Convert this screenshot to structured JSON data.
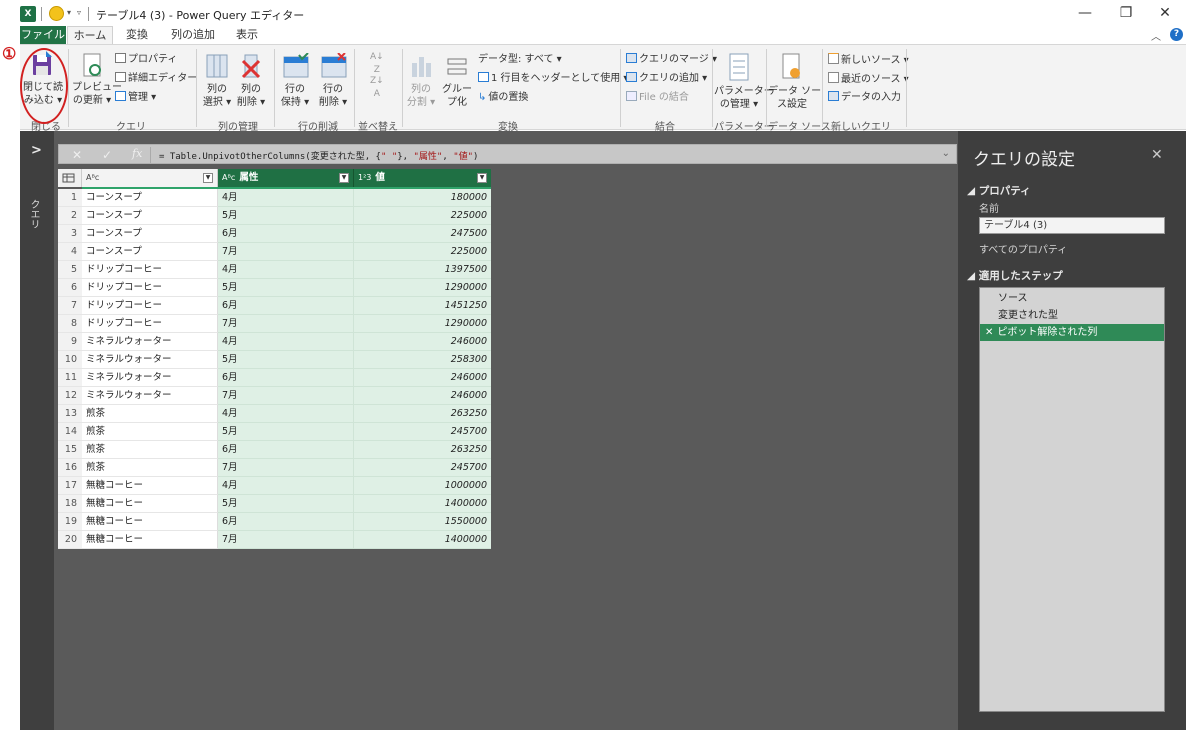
{
  "window": {
    "title": "テーブル4 (3) - Power Query エディター",
    "app_icon": "excel-icon",
    "controls": [
      "—",
      "❐",
      "✕"
    ]
  },
  "tabs": [
    "ファイル",
    "ホーム",
    "変換",
    "列の追加",
    "表示"
  ],
  "ribbon": {
    "close": {
      "line1": "閉じて読",
      "line2": "み込む ▾",
      "group": "閉じる"
    },
    "query": {
      "preview_line1": "プレビュー",
      "preview_line2": "の更新 ▾",
      "properties": "プロパティ",
      "advanced_editor": "詳細エディター",
      "manage": "管理 ▾",
      "group": "クエリ"
    },
    "manage_columns": {
      "choose_line1": "列の",
      "choose_line2": "選択 ▾",
      "remove_line1": "列の",
      "remove_line2": "削除 ▾",
      "group": "列の管理"
    },
    "reduce_rows": {
      "keep_line1": "行の",
      "keep_line2": "保持 ▾",
      "remove_line1": "行の",
      "remove_line2": "削除 ▾",
      "group": "行の削減"
    },
    "sort": {
      "group": "並べ替え"
    },
    "transform": {
      "split_line1": "列の",
      "split_line2": "分割 ▾",
      "group_line1": "グルー",
      "group_line2": "プ化",
      "data_type": "データ型: すべて ▾",
      "first_row_header": "1 行目をヘッダーとして使用 ▾",
      "replace_values": "値の置換",
      "group": "変換"
    },
    "combine": {
      "merge": "クエリのマージ ▾",
      "append": "クエリの追加 ▾",
      "combine_files": "File の結合",
      "group": "結合"
    },
    "parameters": {
      "line1": "パラメーター",
      "line2": "の管理 ▾",
      "group": "パラメーター"
    },
    "data_sources": {
      "line1": "データ ソー",
      "line2": "ス設定",
      "group": "データ ソース"
    },
    "new_query": {
      "new_source": "新しいソース ▾",
      "recent_sources": "最近のソース ▾",
      "enter_data": "データの入力",
      "group": "新しいクエリ"
    }
  },
  "annotation": {
    "number": "①",
    "color": "#d22020"
  },
  "left_pane": {
    "label": "クエリ",
    "toggle": ">"
  },
  "formula_bar": {
    "cancel": "✕",
    "commit": "✓",
    "fx": "fx",
    "prefix": "= Table.UnpivotOtherColumns(変更された型, {",
    "str1": "\" \"",
    "mid": "}, ",
    "str2": "\"属性\"",
    "comma": ", ",
    "str3": "\"値\"",
    "suffix": ")"
  },
  "grid": {
    "columns": [
      {
        "type": "Aᴮᴄ",
        "name": ""
      },
      {
        "type": "Aᴮᴄ",
        "name": "属性"
      },
      {
        "type": "1²3",
        "name": "値"
      }
    ],
    "rows": [
      {
        "n": "1",
        "a": "コーンスープ",
        "b": "4月",
        "c": "180000"
      },
      {
        "n": "2",
        "a": "コーンスープ",
        "b": "5月",
        "c": "225000"
      },
      {
        "n": "3",
        "a": "コーンスープ",
        "b": "6月",
        "c": "247500"
      },
      {
        "n": "4",
        "a": "コーンスープ",
        "b": "7月",
        "c": "225000"
      },
      {
        "n": "5",
        "a": "ドリップコーヒー",
        "b": "4月",
        "c": "1397500"
      },
      {
        "n": "6",
        "a": "ドリップコーヒー",
        "b": "5月",
        "c": "1290000"
      },
      {
        "n": "7",
        "a": "ドリップコーヒー",
        "b": "6月",
        "c": "1451250"
      },
      {
        "n": "8",
        "a": "ドリップコーヒー",
        "b": "7月",
        "c": "1290000"
      },
      {
        "n": "9",
        "a": "ミネラルウォーター",
        "b": "4月",
        "c": "246000"
      },
      {
        "n": "10",
        "a": "ミネラルウォーター",
        "b": "5月",
        "c": "258300"
      },
      {
        "n": "11",
        "a": "ミネラルウォーター",
        "b": "6月",
        "c": "246000"
      },
      {
        "n": "12",
        "a": "ミネラルウォーター",
        "b": "7月",
        "c": "246000"
      },
      {
        "n": "13",
        "a": "煎茶",
        "b": "4月",
        "c": "263250"
      },
      {
        "n": "14",
        "a": "煎茶",
        "b": "5月",
        "c": "245700"
      },
      {
        "n": "15",
        "a": "煎茶",
        "b": "6月",
        "c": "263250"
      },
      {
        "n": "16",
        "a": "煎茶",
        "b": "7月",
        "c": "245700"
      },
      {
        "n": "17",
        "a": "無糖コーヒー",
        "b": "4月",
        "c": "1000000"
      },
      {
        "n": "18",
        "a": "無糖コーヒー",
        "b": "5月",
        "c": "1400000"
      },
      {
        "n": "19",
        "a": "無糖コーヒー",
        "b": "6月",
        "c": "1550000"
      },
      {
        "n": "20",
        "a": "無糖コーヒー",
        "b": "7月",
        "c": "1400000"
      }
    ]
  },
  "query_settings": {
    "title": "クエリの設定",
    "close": "✕",
    "properties_header": "◢ プロパティ",
    "name_label": "名前",
    "name_value": "テーブル4 (3)",
    "all_properties": "すべてのプロパティ",
    "steps_header": "◢ 適用したステップ",
    "steps": [
      "ソース",
      "変更された型",
      "ピボット解除された列"
    ],
    "active_step_marker": "✕"
  },
  "colors": {
    "excel_green": "#217346",
    "selected_column": "#1f7044",
    "selected_cells": "#dff0e5",
    "dark_bg": "#5a5a5a",
    "panel_bg": "#3e3e3e"
  }
}
